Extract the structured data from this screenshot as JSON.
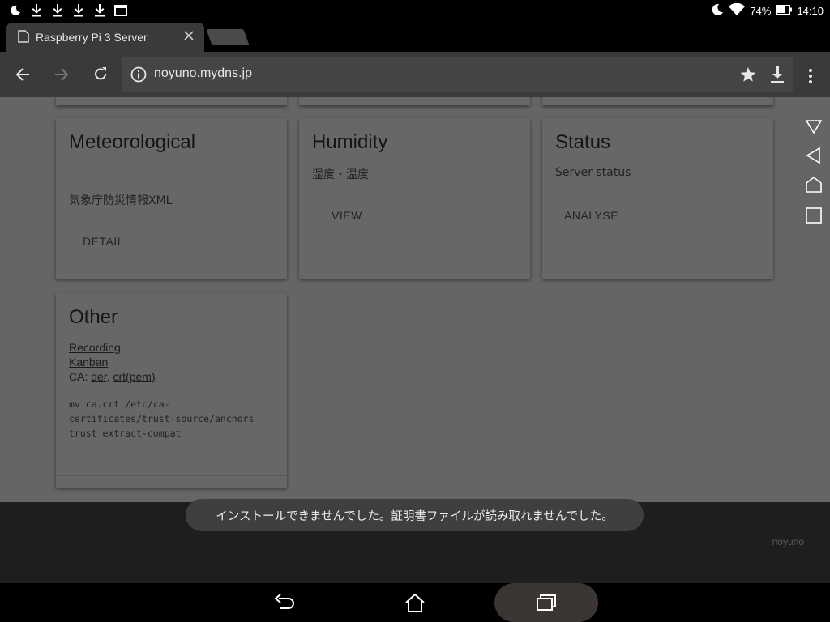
{
  "status_bar": {
    "battery": "74%",
    "time": "14:10"
  },
  "browser": {
    "tab_title": "Raspberry Pi 3 Server",
    "url": "noyuno.mydns.jp"
  },
  "cards": {
    "meteorological": {
      "title": "Meteorological",
      "subtitle": "気象庁防災情報XML",
      "action": "DETAIL"
    },
    "humidity": {
      "title": "Humidity",
      "subtitle": "湿度・温度",
      "action": "VIEW"
    },
    "status": {
      "title": "Status",
      "subtitle": "Server status",
      "action": "ANALYSE"
    },
    "other": {
      "title": "Other",
      "links": [
        "Recording",
        "Kanban"
      ],
      "ca_label": "CA: ",
      "ca_der": "der",
      "ca_sep": ", ",
      "ca_crt": "crt(pem)",
      "code": "mv ca.crt /etc/ca-\ncertificates/trust-source/anchors\ntrust extract-compat"
    }
  },
  "toast": {
    "message": "インストールできませんでした。証明書ファイルが読み取れませんでした。"
  },
  "footer": {
    "brand": "noyuno"
  }
}
